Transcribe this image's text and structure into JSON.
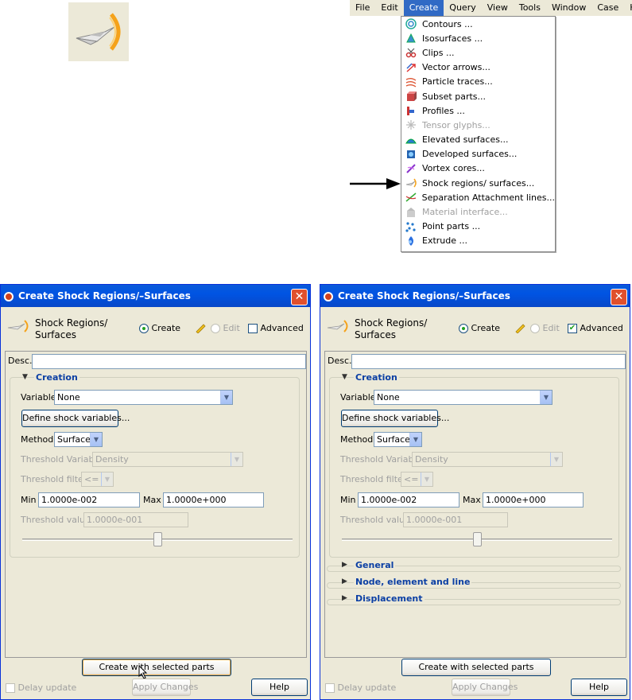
{
  "menubar": {
    "items": [
      "File",
      "Edit",
      "Create",
      "Query",
      "View",
      "Tools",
      "Window",
      "Case",
      "Help"
    ],
    "active": "Create"
  },
  "create_menu": [
    {
      "label": "Contours ...",
      "icon": "contours-icon",
      "enabled": true
    },
    {
      "label": "Isosurfaces ...",
      "icon": "isosurfaces-icon",
      "enabled": true
    },
    {
      "label": "Clips ...",
      "icon": "clips-icon",
      "enabled": true
    },
    {
      "label": "Vector arrows...",
      "icon": "vector-arrows-icon",
      "enabled": true
    },
    {
      "label": "Particle traces...",
      "icon": "particle-traces-icon",
      "enabled": true
    },
    {
      "label": "Subset parts...",
      "icon": "subset-parts-icon",
      "enabled": true
    },
    {
      "label": "Profiles ...",
      "icon": "profiles-icon",
      "enabled": true
    },
    {
      "label": "Tensor glyphs...",
      "icon": "tensor-glyphs-icon",
      "enabled": false
    },
    {
      "label": "Elevated surfaces...",
      "icon": "elevated-surfaces-icon",
      "enabled": true
    },
    {
      "label": "Developed surfaces...",
      "icon": "developed-surfaces-icon",
      "enabled": true
    },
    {
      "label": "Vortex cores...",
      "icon": "vortex-cores-icon",
      "enabled": true
    },
    {
      "label": "Shock regions/ surfaces...",
      "icon": "shock-regions-icon",
      "enabled": true
    },
    {
      "label": "Separation  Attachment lines...",
      "icon": "separation-lines-icon",
      "enabled": true
    },
    {
      "label": "Material interface...",
      "icon": "material-interface-icon",
      "enabled": false
    },
    {
      "label": "Point parts ...",
      "icon": "point-parts-icon",
      "enabled": true
    },
    {
      "label": "Extrude ...",
      "icon": "extrude-icon",
      "enabled": true
    }
  ],
  "dialog_left": {
    "title": "Create Shock Regions/–Surfaces",
    "header_title": "Shock Regions/ Surfaces",
    "mode_create": "Create",
    "mode_edit": "Edit",
    "advanced_label": "Advanced",
    "advanced_checked": false,
    "desc_label": "Desc.",
    "desc_value": "",
    "section_creation": "Creation",
    "variable_label": "Variable",
    "variable_value": "None",
    "define_button": "Define shock variables...",
    "method_label": "Method",
    "method_value": "Surface",
    "threshold_variable_label": "Threshold Variable",
    "threshold_variable_value": "Density",
    "threshold_filter_label": "Threshold filter",
    "threshold_filter_value": "<=",
    "min_label": "Min",
    "min_value": "1.0000e-002",
    "max_label": "Max",
    "max_value": "1.0000e+000",
    "threshold_value_label": "Threshold value",
    "threshold_value": "1.0000e-001",
    "slider_level": 0.5,
    "create_button": "Create with selected parts",
    "delay_update_label": "Delay update",
    "apply_button": "Apply Changes",
    "help_button": "Help"
  },
  "dialog_right": {
    "title": "Create Shock Regions/–Surfaces",
    "header_title": "Shock Regions/ Surfaces",
    "mode_create": "Create",
    "mode_edit": "Edit",
    "advanced_label": "Advanced",
    "advanced_checked": true,
    "desc_label": "Desc.",
    "desc_value": "",
    "section_creation": "Creation",
    "variable_label": "Variable",
    "variable_value": "None",
    "define_button": "Define shock variables...",
    "method_label": "Method",
    "method_value": "Surface",
    "threshold_variable_label": "Threshold Variable",
    "threshold_variable_value": "Density",
    "threshold_filter_label": "Threshold filter",
    "threshold_filter_value": "<=",
    "min_label": "Min",
    "min_value": "1.0000e-002",
    "max_label": "Max",
    "max_value": "1.0000e+000",
    "threshold_value_label": "Threshold value",
    "threshold_value": "1.0000e-001",
    "slider_level": 0.5,
    "section_general": "General",
    "section_node": "Node, element and line",
    "section_displacement": "Displacement",
    "create_button": "Create with selected parts",
    "delay_update_label": "Delay update",
    "apply_button": "Apply Changes",
    "help_button": "Help"
  },
  "colors": {
    "title_bar": "#0054e3",
    "section_title": "#0b3fa4",
    "dialog_bg": "#ece9d8",
    "menu_highlight": "#316ac5"
  }
}
